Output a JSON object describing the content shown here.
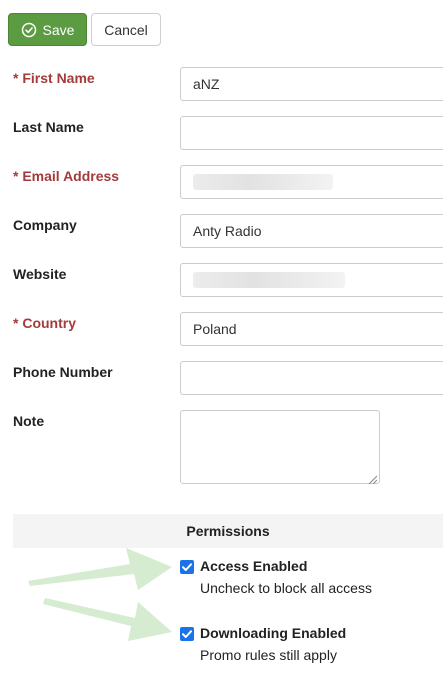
{
  "toolbar": {
    "save_label": "Save",
    "cancel_label": "Cancel"
  },
  "form": {
    "fields": [
      {
        "label": "First Name",
        "required": true,
        "value": "aNZ"
      },
      {
        "label": "Last Name",
        "required": false,
        "value": ""
      },
      {
        "label": "Email Address",
        "required": true,
        "value": ""
      },
      {
        "label": "Company",
        "required": false,
        "value": "Anty Radio"
      },
      {
        "label": "Website",
        "required": false,
        "value": ""
      },
      {
        "label": "Country",
        "required": true,
        "value": "Poland"
      },
      {
        "label": "Phone Number",
        "required": false,
        "value": ""
      },
      {
        "label": "Note",
        "required": false,
        "value": ""
      }
    ]
  },
  "permissions": {
    "title": "Permissions",
    "items": [
      {
        "label": "Access Enabled",
        "description": "Uncheck to block all access",
        "checked": true
      },
      {
        "label": "Downloading Enabled",
        "description": "Promo rules still apply",
        "checked": true
      }
    ]
  },
  "colors": {
    "save_button": "#5b9b41",
    "required_label": "#a33b3b",
    "checkbox": "#1a73e8",
    "arrow": "#d5ecd0"
  },
  "icons": {
    "save": "check-circle-icon",
    "textarea_grip": "resize-grip-icon",
    "callout": "arrow-right-icon"
  }
}
